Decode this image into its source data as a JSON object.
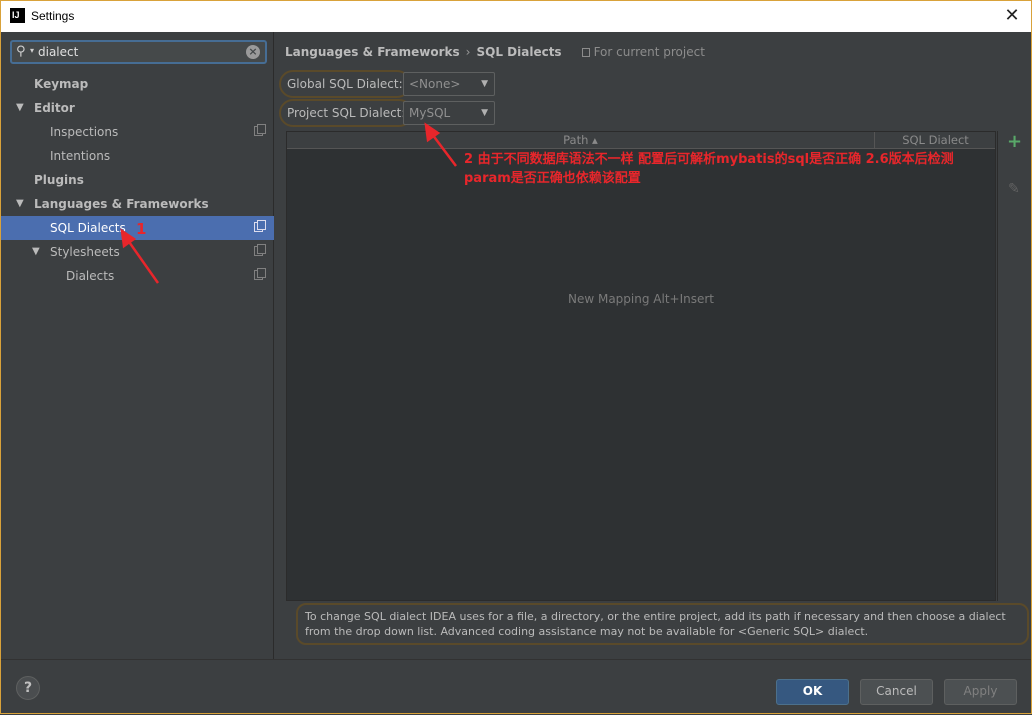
{
  "window": {
    "title": "Settings",
    "close_label": "✕",
    "app_icon_label": "IJ"
  },
  "search": {
    "value": "dialect"
  },
  "tree": {
    "keymap": "Keymap",
    "editor": "Editor",
    "inspections": "Inspections",
    "intentions": "Intentions",
    "plugins": "Plugins",
    "languages": "Languages & Frameworks",
    "sql_dialects": "SQL Dialects",
    "stylesheets": "Stylesheets",
    "dialects": "Dialects"
  },
  "breadcrumb": {
    "parent": "Languages & Frameworks",
    "separator": "›",
    "current": "SQL Dialects",
    "scope": "For current project"
  },
  "global_dialect": {
    "label": "Global SQL Dialect:",
    "value": "<None>"
  },
  "project_dialect": {
    "label": "Project SQL Dialect:",
    "value": "MySQL"
  },
  "table": {
    "columns": [
      "Path ▴",
      "SQL Dialect"
    ],
    "empty_text": "New Mapping Alt+Insert"
  },
  "help_text": "To change SQL dialect IDEA uses for a file, a directory, or the entire project, add its path if necessary and then choose a dialect from the drop down list. Advanced coding assistance may not be available for <Generic SQL> dialect.",
  "buttons": {
    "ok": "OK",
    "cancel": "Cancel",
    "apply": "Apply",
    "help": "?"
  },
  "annotations": {
    "one": "1",
    "two_line1": "2 由于不同数据库语法不一样  配置后可解析mybatis的sql是否正确  2.6版本后检测",
    "two_line2": "param是否正确也依赖该配置"
  },
  "colors": {
    "selection": "#4b6eaf",
    "annotation": "#e8262b",
    "ok_button": "#365880"
  }
}
